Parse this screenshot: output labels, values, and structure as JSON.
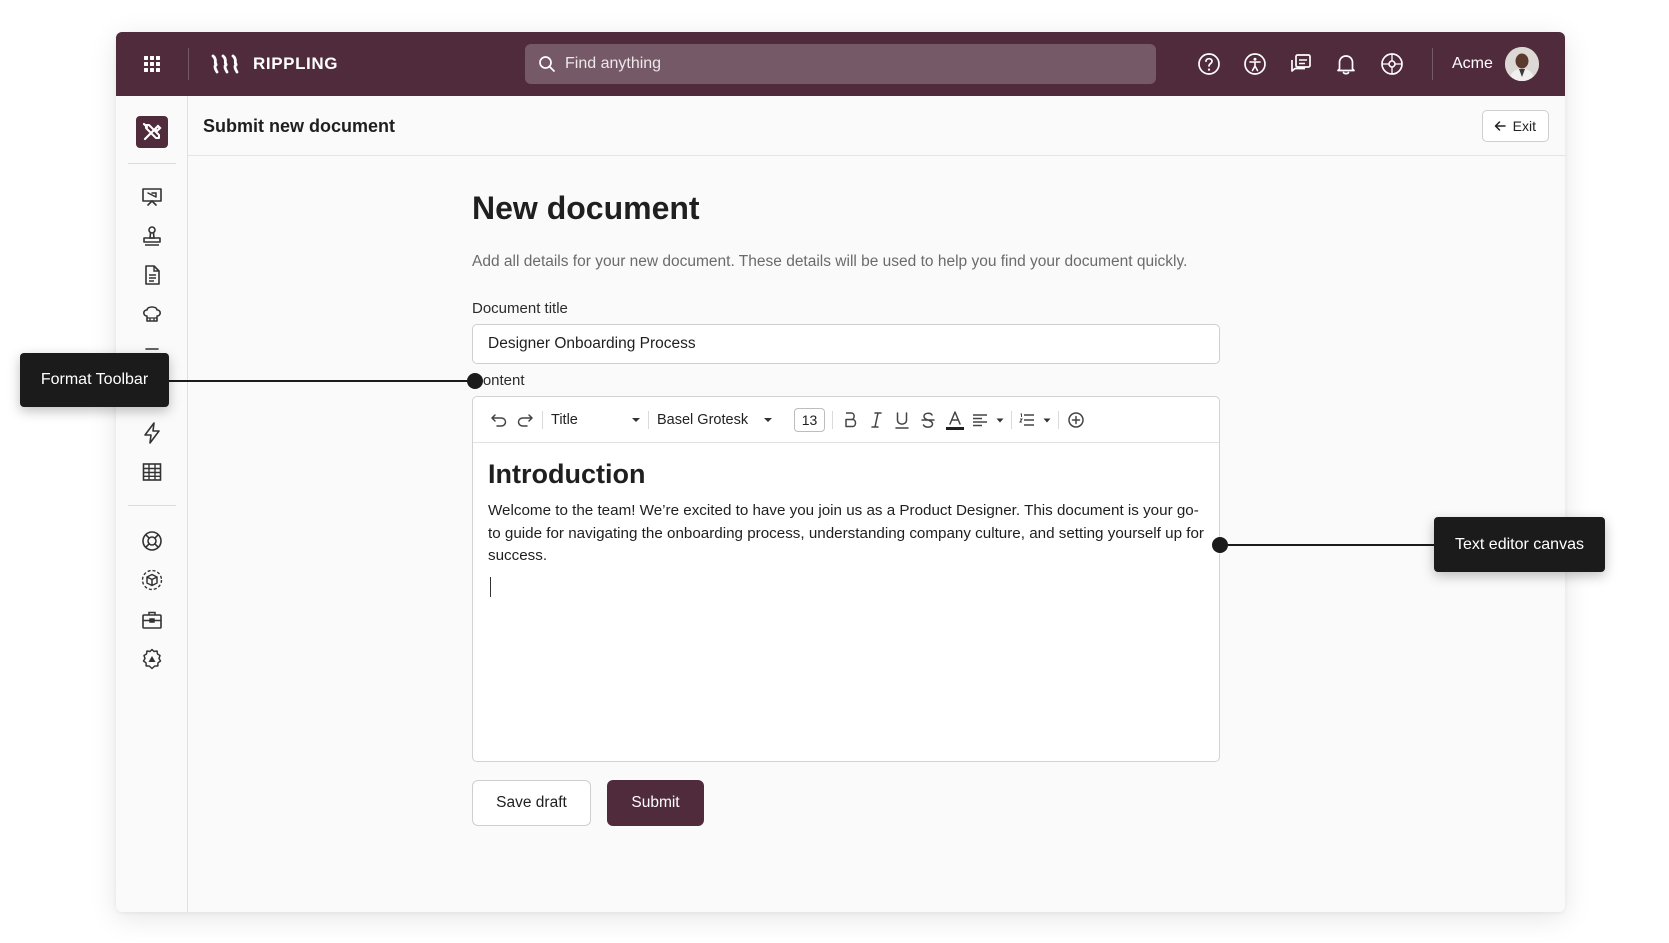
{
  "topbar": {
    "logo_text": "RIPPLING",
    "search_placeholder": "Find anything",
    "company_name": "Acme",
    "icons": [
      "apps-grid-icon",
      "help-icon",
      "accessibility-icon",
      "chat-icon",
      "bell-icon",
      "support-icon"
    ]
  },
  "sidebar": {
    "app_icon": "tools-icon",
    "icons": [
      "present-icon",
      "stamp-icon",
      "document-icon",
      "chef-hat-icon",
      "lightning-icon",
      "table-icon",
      "lifebuoy-icon",
      "cube-icon",
      "briefcase-icon",
      "settings-icon"
    ]
  },
  "page_header": {
    "title": "Submit new document",
    "exit_label": "Exit"
  },
  "form": {
    "heading": "New document",
    "subtitle": "Add all details for your new document. These details will be used to help you find your document quickly.",
    "doc_title_label": "Document title",
    "doc_title_value": "Designer Onboarding Process",
    "content_label": "Content"
  },
  "toolbar": {
    "style_value": "Title",
    "font_value": "Basel Grotesk",
    "font_size": "13",
    "icons": [
      "undo-icon",
      "redo-icon",
      "bold-icon",
      "italic-icon",
      "underline-icon",
      "strikethrough-icon",
      "text-color-icon",
      "align-icon",
      "list-icon",
      "insert-icon"
    ]
  },
  "editor": {
    "heading": "Introduction",
    "paragraph": "Welcome to the team! We’re excited to have you join us as a Product Designer. This document is your go-to guide for navigating the onboarding process, understanding company culture, and setting yourself up for success."
  },
  "actions": {
    "save_draft": "Save draft",
    "submit": "Submit"
  },
  "annotations": {
    "format_toolbar": "Format Toolbar",
    "text_editor_canvas": "Text editor canvas"
  },
  "colors": {
    "brand": "#502b3c",
    "callout": "#1b1b1b"
  }
}
